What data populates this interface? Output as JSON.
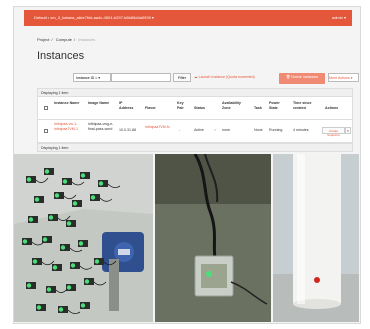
{
  "topbar": {
    "project": "Default • vm_3_katana_alice7hkt-aa4c-4501-b297-b6b65d4a0939 ▾",
    "user": "admin ▾"
  },
  "breadcrumb": {
    "project": "Project",
    "compute": "Compute",
    "current": "Instances"
  },
  "page_title": "Instances",
  "toolbar": {
    "filter_select": "Instance ID = ▾",
    "filter_placeholder": "",
    "filter_button": "Filter",
    "launch": "Launch Instance (Quota exceeded)",
    "delete": "Delete Instances",
    "more": "More Actions ▾"
  },
  "displaying_top": "Displaying 1 item",
  "displaying_bottom": "Displaying 1 item",
  "table": {
    "headers": {
      "instance_name": "Instance Name",
      "image_name": "Image Name",
      "ip": "IP Address",
      "flavor": "Flavor",
      "key_pair": "Key Pair",
      "status": "Status",
      "zone": "Availability Zone",
      "task": "Task",
      "power": "Power State",
      "time": "Time since created",
      "actions": "Actions"
    },
    "row": {
      "instance_name": "infinipaa-vw-1-infinipaa7VM-1",
      "image_name": "infinipaa-vwg-e-final-pass-word",
      "ip": "10.0.31.88",
      "flavor": "infinipaa7VM-fv",
      "key_pair": "-",
      "status": "Active",
      "zone": "none",
      "task": "None",
      "power": "Running",
      "time": "4 minutes",
      "action": "Create Snapshot"
    }
  },
  "colors": {
    "accent": "#e4573a",
    "led_green": "#49e07a"
  }
}
